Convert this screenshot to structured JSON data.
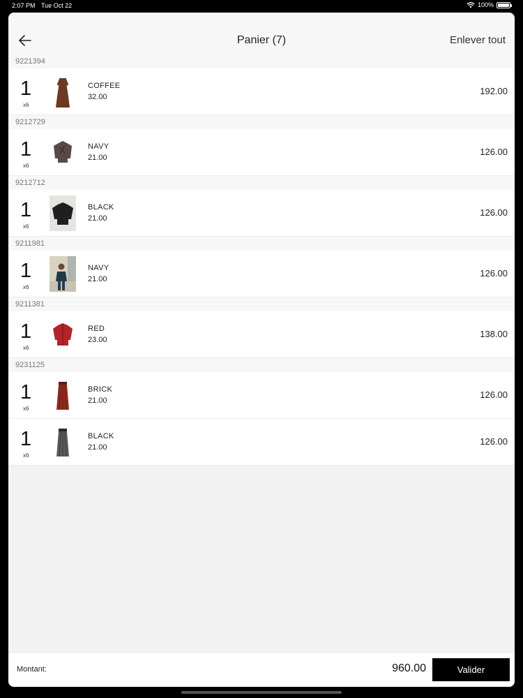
{
  "status": {
    "time": "2:07 PM",
    "date": "Tue Oct 22",
    "battery": "100%",
    "battery_level": 1.0
  },
  "header": {
    "title": "Panier (7)",
    "clear_all": "Enlever tout"
  },
  "groups": [
    {
      "ref": "9221394",
      "items": [
        {
          "qty": "1",
          "multiplier": "x6",
          "color": "COFFEE",
          "unit_price": "32.00",
          "total": "192.00",
          "thumb": "dress-coffee"
        }
      ]
    },
    {
      "ref": "9212729",
      "items": [
        {
          "qty": "1",
          "multiplier": "x6",
          "color": "NAVY",
          "unit_price": "21.00",
          "total": "126.00",
          "thumb": "blouse-navy"
        }
      ]
    },
    {
      "ref": "9212712",
      "items": [
        {
          "qty": "1",
          "multiplier": "x6",
          "color": "BLACK",
          "unit_price": "21.00",
          "total": "126.00",
          "thumb": "top-black"
        }
      ]
    },
    {
      "ref": "9211981",
      "items": [
        {
          "qty": "1",
          "multiplier": "x6",
          "color": "NAVY",
          "unit_price": "21.00",
          "total": "126.00",
          "thumb": "model-photo"
        }
      ]
    },
    {
      "ref": "9211381",
      "items": [
        {
          "qty": "1",
          "multiplier": "x6",
          "color": "RED",
          "unit_price": "23.00",
          "total": "138.00",
          "thumb": "shirt-red"
        }
      ]
    },
    {
      "ref": "9231125",
      "items": [
        {
          "qty": "1",
          "multiplier": "x6",
          "color": "BRICK",
          "unit_price": "21.00",
          "total": "126.00",
          "thumb": "skirt-brick"
        },
        {
          "qty": "1",
          "multiplier": "x6",
          "color": "BLACK",
          "unit_price": "21.00",
          "total": "126.00",
          "thumb": "skirt-black"
        }
      ]
    }
  ],
  "footer": {
    "amount_label": "Montant:",
    "amount": "960.00",
    "validate_label": "Valider"
  }
}
